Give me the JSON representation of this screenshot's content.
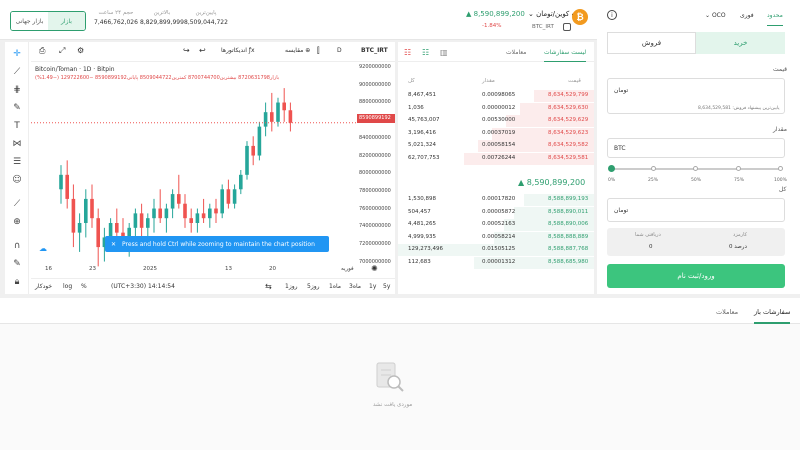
{
  "header": {
    "market_toggle": {
      "active": "بازار",
      "inactive": "بازار جهانی"
    },
    "stats": [
      {
        "label": "حجم ۲۴ ساعت",
        "value": "7,466,762,026"
      },
      {
        "label": "بالاترین",
        "value": "8,829,899,999"
      },
      {
        "label": "پایین‌ترین",
        "value": "8,509,044,722"
      }
    ],
    "pair": {
      "name": "بیت کوین/تومان",
      "symbol": "BTC_IRT",
      "price": "8,590,899,200",
      "change": "-1.84%",
      "logo": "₿"
    }
  },
  "chart": {
    "toolbar": {
      "symbol": "BTC_IRT",
      "interval": "D",
      "compare": "مقایسه",
      "indicators": "اندیکاتورها"
    },
    "legend": {
      "title": "Bitcoin/Toman · 1D · Bitpin",
      "values": "بازار8720631798 بیشترین8700744700 کمترین8509044722 پایانی8590899192 −129722600 (−1.49%)"
    },
    "current_price_tag": "8590899192",
    "notice": "Press and hold Ctrl while zooming to maintain the chart position",
    "notice_icon": "✕",
    "x_ticks": [
      "16",
      "23",
      "2025",
      "13",
      "20",
      "فوریه"
    ],
    "y_ticks": [
      "9200000000",
      "9000000000",
      "8800000000",
      "8600000000",
      "8400000000",
      "8200000000",
      "8000000000",
      "7800000000",
      "7600000000",
      "7400000000",
      "7200000000",
      "7000000000"
    ],
    "ranges": [
      "5y",
      "1y",
      "3ماه",
      "1ماه",
      "5روز",
      "1روز"
    ],
    "timezone": "(UTC+3:30) 14:14:54",
    "bottom_right": {
      "pct": "%",
      "log": "log",
      "auto": "خودکار"
    }
  },
  "chart_data": {
    "type": "candlestick",
    "ylim": [
      7000000000,
      9200000000
    ],
    "candles": [
      [
        7900000000,
        8150000000,
        7750000000,
        8050000000
      ],
      [
        8050000000,
        8200000000,
        7700000000,
        7800000000
      ],
      [
        7800000000,
        7950000000,
        7300000000,
        7450000000
      ],
      [
        7450000000,
        7650000000,
        7250000000,
        7550000000
      ],
      [
        7550000000,
        7900000000,
        7400000000,
        7800000000
      ],
      [
        7800000000,
        7950000000,
        7500000000,
        7600000000
      ],
      [
        7600000000,
        7700000000,
        7100000000,
        7300000000
      ],
      [
        7300000000,
        7500000000,
        7150000000,
        7400000000
      ],
      [
        7400000000,
        7600000000,
        7300000000,
        7550000000
      ],
      [
        7550000000,
        7700000000,
        7350000000,
        7450000000
      ],
      [
        7450000000,
        7600000000,
        7250000000,
        7350000000
      ],
      [
        7350000000,
        7550000000,
        7200000000,
        7500000000
      ],
      [
        7500000000,
        7700000000,
        7400000000,
        7650000000
      ],
      [
        7650000000,
        7750000000,
        7400000000,
        7500000000
      ],
      [
        7500000000,
        7650000000,
        7350000000,
        7600000000
      ],
      [
        7600000000,
        7800000000,
        7450000000,
        7700000000
      ],
      [
        7700000000,
        7900000000,
        7550000000,
        7600000000
      ],
      [
        7600000000,
        7750000000,
        7450000000,
        7700000000
      ],
      [
        7700000000,
        7900000000,
        7600000000,
        7850000000
      ],
      [
        7850000000,
        8050000000,
        7700000000,
        7750000000
      ],
      [
        7750000000,
        7850000000,
        7500000000,
        7600000000
      ],
      [
        7600000000,
        7700000000,
        7450000000,
        7550000000
      ],
      [
        7550000000,
        7700000000,
        7450000000,
        7650000000
      ],
      [
        7650000000,
        7800000000,
        7550000000,
        7600000000
      ],
      [
        7600000000,
        7750000000,
        7500000000,
        7700000000
      ],
      [
        7700000000,
        7800000000,
        7550000000,
        7650000000
      ],
      [
        7650000000,
        7950000000,
        7600000000,
        7900000000
      ],
      [
        7900000000,
        8000000000,
        7700000000,
        7750000000
      ],
      [
        7750000000,
        7950000000,
        7700000000,
        7900000000
      ],
      [
        7900000000,
        8100000000,
        7850000000,
        8050000000
      ],
      [
        8050000000,
        8400000000,
        8000000000,
        8350000000
      ],
      [
        8350000000,
        8450000000,
        8150000000,
        8250000000
      ],
      [
        8250000000,
        8600000000,
        8200000000,
        8550000000
      ],
      [
        8550000000,
        8800000000,
        8450000000,
        8700000000
      ],
      [
        8700000000,
        8900000000,
        8500000000,
        8600000000
      ],
      [
        8600000000,
        8850000000,
        8550000000,
        8800000000
      ],
      [
        8800000000,
        8950000000,
        8600000000,
        8720000000
      ],
      [
        8720000000,
        8800000000,
        8500000000,
        8590000000
      ]
    ]
  },
  "book": {
    "tabs": [
      "لیست سفارشات",
      "معاملات"
    ],
    "columns": {
      "price": "قیمت",
      "amount": "مقدار",
      "total": "کل"
    },
    "asks": [
      {
        "price": "8,634,529,799",
        "amount": "0.00098065",
        "total": "8,467,451"
      },
      {
        "price": "8,634,529,630",
        "amount": "0.00000012",
        "total": "1,036"
      },
      {
        "price": "8,634,529,629",
        "amount": "0.00530000",
        "total": "45,763,007"
      },
      {
        "price": "8,634,529,623",
        "amount": "0.00037019",
        "total": "3,196,416"
      },
      {
        "price": "8,634,529,582",
        "amount": "0.00058154",
        "total": "5,021,324"
      },
      {
        "price": "8,634,529,581",
        "amount": "0.00726244",
        "total": "62,707,753"
      }
    ],
    "mid_price": "8,590,899,200",
    "bids": [
      {
        "price": "8,588,899,193",
        "amount": "0.00017820",
        "total": "1,530,898"
      },
      {
        "price": "8,588,890,011",
        "amount": "0.00005872",
        "total": "504,457"
      },
      {
        "price": "8,588,890,006",
        "amount": "0.00052163",
        "total": "4,481,265"
      },
      {
        "price": "8,588,888,889",
        "amount": "0.00058214",
        "total": "4,999,935"
      },
      {
        "price": "8,588,887,768",
        "amount": "0.01505125",
        "total": "129,273,496"
      },
      {
        "price": "8,588,685,980",
        "amount": "0.00001312",
        "total": "112,683"
      }
    ]
  },
  "form": {
    "order_types": [
      "محدود",
      "فوری",
      "OCO"
    ],
    "buy": "خرید",
    "sell": "فروش",
    "price_label": "قیمت",
    "price_unit": "تومان",
    "price_hint": "پایین‌ترین پیشنهاد فروش: 8,634,529,581",
    "amount_label": "مقدار",
    "amount_unit": "BTC",
    "slider_labels": [
      "0%",
      "25%",
      "50%",
      "75%",
      "100%"
    ],
    "total_label": "کل",
    "total_unit": "تومان",
    "fee_label": "کارمزد",
    "fee_value": "0 درصد",
    "receive_label": "دریافتی شما",
    "receive_value": "0",
    "submit": "ورود/ثبت نام",
    "info_icon": "i"
  },
  "bottom": {
    "tabs": [
      "سفارشات باز",
      "معاملات"
    ],
    "empty_text": "موردی یافت نشد"
  }
}
